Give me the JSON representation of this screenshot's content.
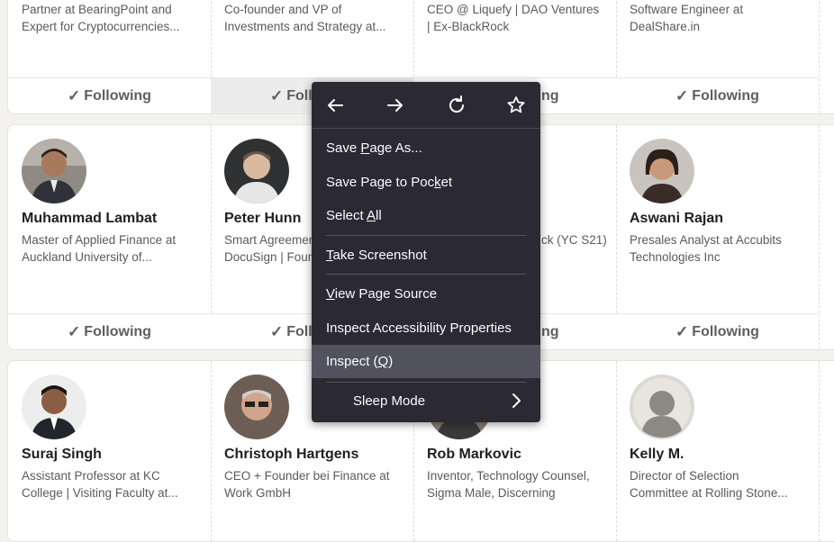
{
  "cards_row1": [
    {
      "headline": [
        "Partner at BearingPoint and",
        "Expert for Cryptocurrencies..."
      ],
      "follow": "Following"
    },
    {
      "headline": [
        "Co-founder and VP of",
        "Investments and Strategy at..."
      ],
      "follow": "Follo"
    },
    {
      "headline": [
        "CEO @ Liquefy | DAO Ventures",
        "| Ex-BlackRock"
      ],
      "follow": "ng"
    },
    {
      "headline": [
        "Software Engineer at",
        "DealShare.in"
      ],
      "follow": "Following"
    }
  ],
  "cards_row2": [
    {
      "name": "Muhammad Lambat",
      "headline": [
        "Master of Applied Finance at",
        "Auckland University of..."
      ],
      "follow": "Following"
    },
    {
      "name": "Peter Hunn",
      "headline": [
        "Smart Agreemen",
        "DocuSign | Foun"
      ],
      "follow": "Follo"
    },
    {
      "name": "",
      "headline": [
        "ck (YC S21)",
        ""
      ],
      "follow": "ng"
    },
    {
      "name": "Aswani Rajan",
      "headline": [
        "Presales Analyst at Accubits",
        "Technologies Inc"
      ],
      "follow": "Following"
    }
  ],
  "cards_row3": [
    {
      "name": "Suraj Singh",
      "headline": [
        "Assistant Professor at KC",
        "College | Visiting Faculty at..."
      ]
    },
    {
      "name": "Christoph Hartgens",
      "headline": [
        "CEO + Founder bei Finance at",
        "Work GmbH"
      ]
    },
    {
      "name": "Rob Markovic",
      "headline": [
        "Inventor, Technology Counsel,",
        "Sigma Male, Discerning"
      ]
    },
    {
      "name": "Kelly M.",
      "headline": [
        "Director of Selection",
        "Committee at Rolling Stone..."
      ]
    }
  ],
  "context_menu": {
    "nav_icons": [
      "back-arrow-icon",
      "forward-arrow-icon",
      "reload-icon",
      "bookmark-star-icon"
    ],
    "save_page_as": {
      "pre": "Save ",
      "key": "P",
      "post": "age As..."
    },
    "save_to_pocket": {
      "pre": "Save Page to Poc",
      "key": "k",
      "post": "et"
    },
    "select_all": {
      "pre": "Select ",
      "key": "A",
      "post": "ll"
    },
    "take_screenshot": {
      "pre": "",
      "key": "T",
      "post": "ake Screenshot"
    },
    "view_source": {
      "pre": "",
      "key": "V",
      "post": "iew Page Source"
    },
    "inspect_accessibility": "Inspect Accessibility Properties",
    "inspect": {
      "pre": "Inspect (",
      "key": "Q",
      "post": ")"
    },
    "sleep_mode": "Sleep Mode"
  },
  "colors": {
    "menu_bg": "#2b2a33",
    "menu_highlight": "#52525e",
    "page_bg": "#f3f2ef"
  }
}
